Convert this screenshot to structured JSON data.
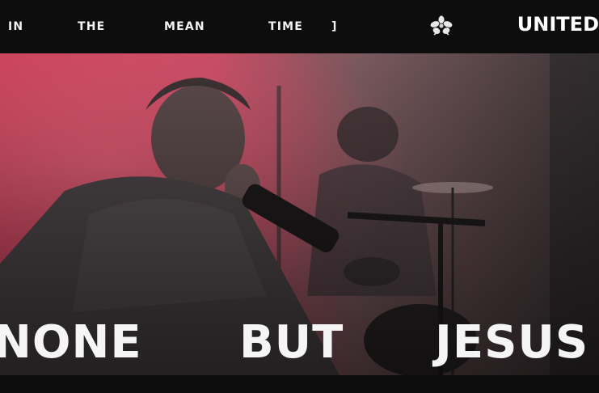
{
  "header": {
    "words": [
      "IN",
      "THE",
      "MEAN",
      "TIME",
      "]"
    ],
    "logo_icon": "flower-icon",
    "brand": "UNITED"
  },
  "hero": {
    "headline": [
      "NONE",
      "BUT",
      "JESUS"
    ],
    "image_description_icon": "live-performance-photo"
  },
  "colors": {
    "bar_background": "#0d0d0d",
    "photo_tint": "#d0455a",
    "text": "#f2f2f2"
  }
}
